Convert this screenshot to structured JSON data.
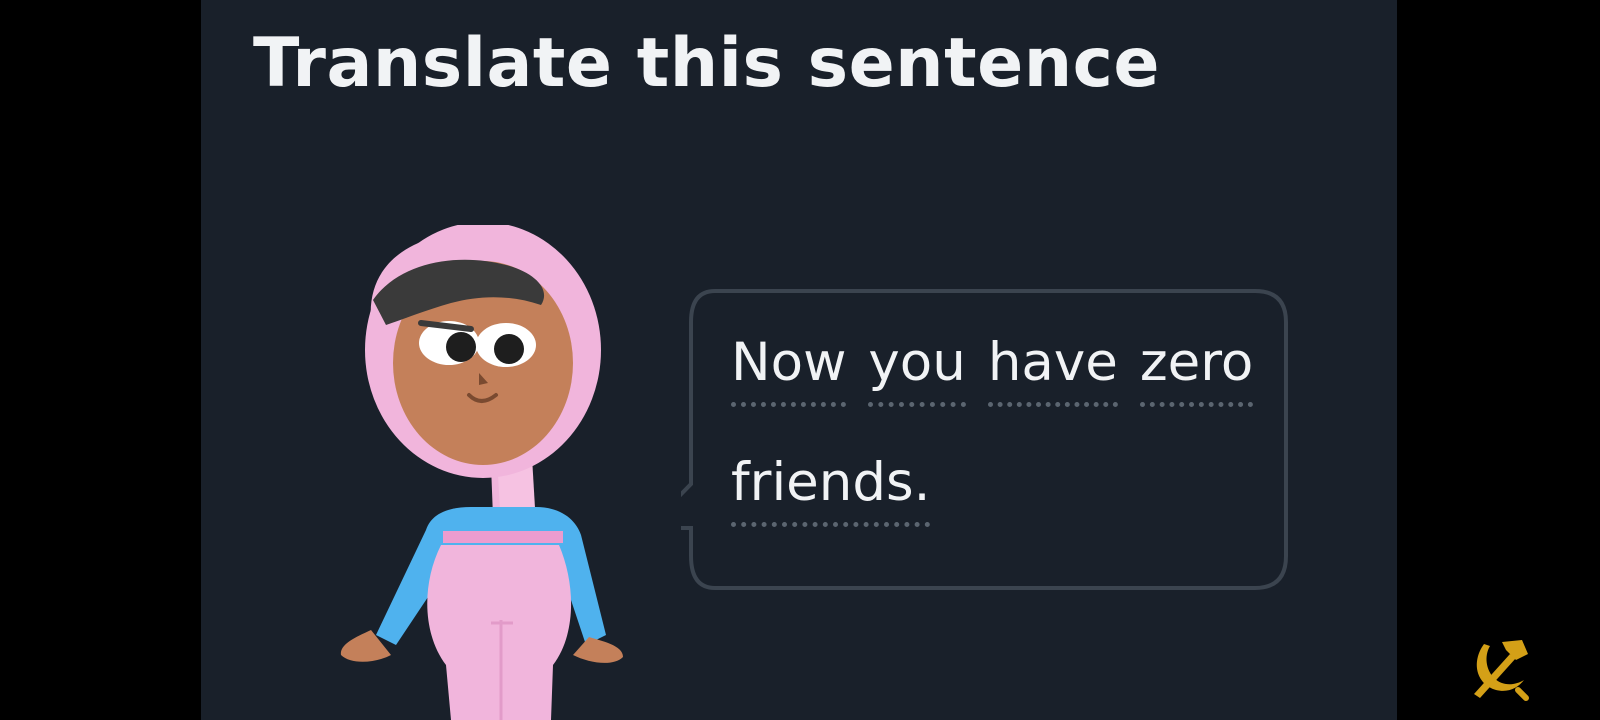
{
  "challenge": {
    "heading": "Translate this sentence"
  },
  "prompt": {
    "words": [
      "Now",
      "you",
      "have",
      "zero",
      "friends."
    ]
  },
  "colors": {
    "background": "#19202a",
    "text": "#f1f3f5",
    "bubble_border": "#3b444f",
    "hint_underline": "#5b6570",
    "character_hijab": "#f1b5dc",
    "character_shirt": "#4fb2ee",
    "character_skin": "#c4805a"
  },
  "icons": {
    "character": "character-illustration",
    "overlay": "hammer-sickle-icon"
  }
}
